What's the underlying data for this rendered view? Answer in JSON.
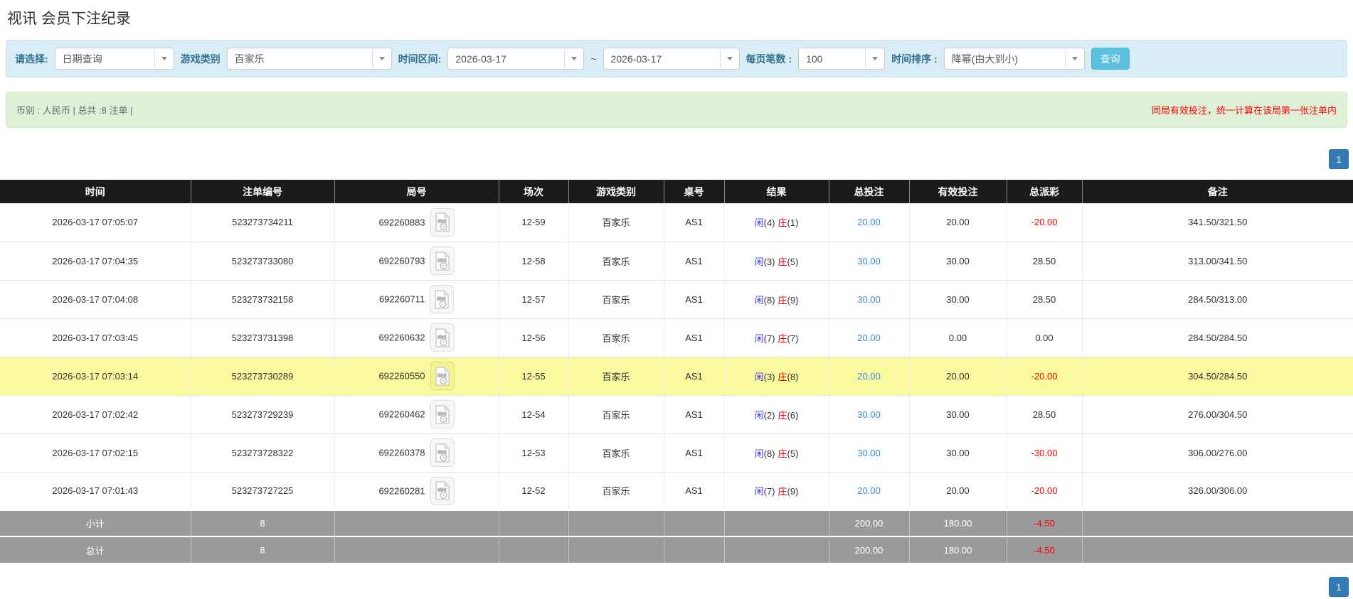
{
  "page": {
    "title": "视讯 会员下注纪录"
  },
  "colors": {
    "filter_bar_bg": "#d9edf7",
    "summary_bar_bg": "#dff0d8",
    "table_header_bg": "#1b1b1b",
    "highlight_row": "#f9f9a0",
    "total_bet_blue": "#3a86f0",
    "player_blue": "#3333e6",
    "banker_red": "#e60000",
    "negative_red": "#ff0000",
    "search_button_cyan": "#5bc0de",
    "pagination_blue": "#337ab7"
  },
  "filters": {
    "query_type_label": "请选择:",
    "query_type_value": "日期查询",
    "game_type_label": "游戏类别",
    "game_type_value": "百家乐",
    "time_range_label": "时间区间:",
    "date_from": "2026-03-17",
    "tilde": "~",
    "date_to": "2026-03-17",
    "page_size_label": "每页笔数 :",
    "page_size_value": "100",
    "sort_label": "时间排序 :",
    "sort_value": "降幂(由大到小)",
    "search_button": "查询"
  },
  "summary_bar": {
    "left_text": "币别 : 人民币 | 总共 :8 注单 |",
    "right_notice": "同局有效投注，统一计算在该局第一张注单内"
  },
  "pagination": {
    "page": "1"
  },
  "table": {
    "headers": [
      "时间",
      "注单编号",
      "局号",
      "场次",
      "游戏类别",
      "桌号",
      "结果",
      "总投注",
      "有效投注",
      "总派彩",
      "备注"
    ],
    "rows": [
      {
        "time": "2026-03-17 07:05:07",
        "bet_id": "523273734211",
        "round": "692260883",
        "session": "12-59",
        "game": "百家乐",
        "table_no": "AS1",
        "result": {
          "player_label": "闲",
          "player_value": "(4)",
          "banker_label": "庄",
          "banker_value": "(1)"
        },
        "total_bet": "20.00",
        "valid_bet": "20.00",
        "payout": "-20.00",
        "remark": "341.50/321.50",
        "highlight": false
      },
      {
        "time": "2026-03-17 07:04:35",
        "bet_id": "523273733080",
        "round": "692260793",
        "session": "12-58",
        "game": "百家乐",
        "table_no": "AS1",
        "result": {
          "player_label": "闲",
          "player_value": "(3)",
          "banker_label": "庄",
          "banker_value": "(5)"
        },
        "total_bet": "30.00",
        "valid_bet": "30.00",
        "payout": "28.50",
        "remark": "313.00/341.50",
        "highlight": false
      },
      {
        "time": "2026-03-17 07:04:08",
        "bet_id": "523273732158",
        "round": "692260711",
        "session": "12-57",
        "game": "百家乐",
        "table_no": "AS1",
        "result": {
          "player_label": "闲",
          "player_value": "(8)",
          "banker_label": "庄",
          "banker_value": "(9)"
        },
        "total_bet": "30.00",
        "valid_bet": "30.00",
        "payout": "28.50",
        "remark": "284.50/313.00",
        "highlight": false
      },
      {
        "time": "2026-03-17 07:03:45",
        "bet_id": "523273731398",
        "round": "692260632",
        "session": "12-56",
        "game": "百家乐",
        "table_no": "AS1",
        "result": {
          "player_label": "闲",
          "player_value": "(7)",
          "banker_label": "庄",
          "banker_value": "(7)"
        },
        "total_bet": "20.00",
        "valid_bet": "0.00",
        "payout": "0.00",
        "remark": "284.50/284.50",
        "highlight": false
      },
      {
        "time": "2026-03-17 07:03:14",
        "bet_id": "523273730289",
        "round": "692260550",
        "session": "12-55",
        "game": "百家乐",
        "table_no": "AS1",
        "result": {
          "player_label": "闲",
          "player_value": "(3)",
          "banker_label": "庄",
          "banker_value": "(8)"
        },
        "total_bet": "20.00",
        "valid_bet": "20.00",
        "payout": "-20.00",
        "remark": "304.50/284.50",
        "highlight": true
      },
      {
        "time": "2026-03-17 07:02:42",
        "bet_id": "523273729239",
        "round": "692260462",
        "session": "12-54",
        "game": "百家乐",
        "table_no": "AS1",
        "result": {
          "player_label": "闲",
          "player_value": "(2)",
          "banker_label": "庄",
          "banker_value": "(6)"
        },
        "total_bet": "30.00",
        "valid_bet": "30.00",
        "payout": "28.50",
        "remark": "276.00/304.50",
        "highlight": false
      },
      {
        "time": "2026-03-17 07:02:15",
        "bet_id": "523273728322",
        "round": "692260378",
        "session": "12-53",
        "game": "百家乐",
        "table_no": "AS1",
        "result": {
          "player_label": "闲",
          "player_value": "(8)",
          "banker_label": "庄",
          "banker_value": "(5)"
        },
        "total_bet": "30.00",
        "valid_bet": "30.00",
        "payout": "-30.00",
        "remark": "306.00/276.00",
        "highlight": false
      },
      {
        "time": "2026-03-17 07:01:43",
        "bet_id": "523273727225",
        "round": "692260281",
        "session": "12-52",
        "game": "百家乐",
        "table_no": "AS1",
        "result": {
          "player_label": "闲",
          "player_value": "(7)",
          "banker_label": "庄",
          "banker_value": "(9)"
        },
        "total_bet": "20.00",
        "valid_bet": "20.00",
        "payout": "-20.00",
        "remark": "326.00/306.00",
        "highlight": false
      }
    ],
    "subtotal": {
      "label": "小计",
      "count": "8",
      "total_bet": "200.00",
      "valid_bet": "180.00",
      "payout": "-4.50"
    },
    "total": {
      "label": "总计",
      "count": "8",
      "total_bet": "200.00",
      "valid_bet": "180.00",
      "payout": "-4.50"
    }
  }
}
